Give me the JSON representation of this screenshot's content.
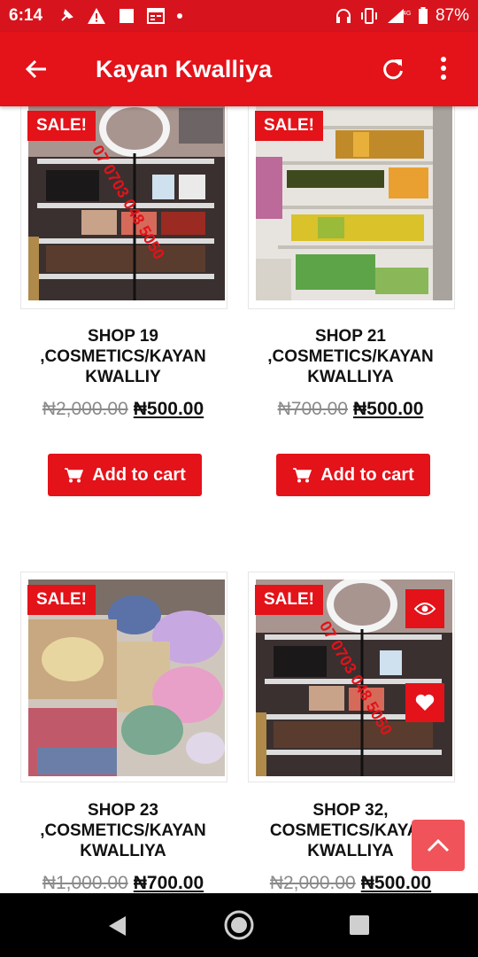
{
  "status_bar": {
    "time": "6:14",
    "network": "4G",
    "battery": "87%"
  },
  "app_bar": {
    "title": "Kayan Kwalliya"
  },
  "products": [
    {
      "sale_badge": "SALE!",
      "name": "SHOP 19 ,COSMETICS/KAYAN KWALLIY",
      "old_price": "₦2,000.00",
      "new_price": "₦500.00",
      "button": "Add to cart",
      "watermark": "07 0703 048 5050"
    },
    {
      "sale_badge": "SALE!",
      "name": "SHOP 21 ,COSMETICS/KAYAN KWALLIYA",
      "old_price": "₦700.00",
      "new_price": "₦500.00",
      "button": "Add to cart"
    },
    {
      "sale_badge": "SALE!",
      "name": "SHOP 23 ,COSMETICS/KAYAN KWALLIYA",
      "old_price": "₦1,000.00",
      "new_price": "₦700.00"
    },
    {
      "sale_badge": "SALE!",
      "name": "SHOP 32, COSMETICS/KAYAN KWALLIYA",
      "old_price": "₦2,000.00",
      "new_price": "₦500.00",
      "watermark": "07 0703 048 5050"
    }
  ],
  "colors": {
    "brand": "#e41219",
    "status_bar": "#d7141d",
    "scroll_top": "#f0535a"
  },
  "icons": [
    "back-arrow-icon",
    "refresh-icon",
    "more-vert-icon",
    "cart-icon",
    "eye-icon",
    "heart-icon",
    "chevron-up-icon"
  ]
}
